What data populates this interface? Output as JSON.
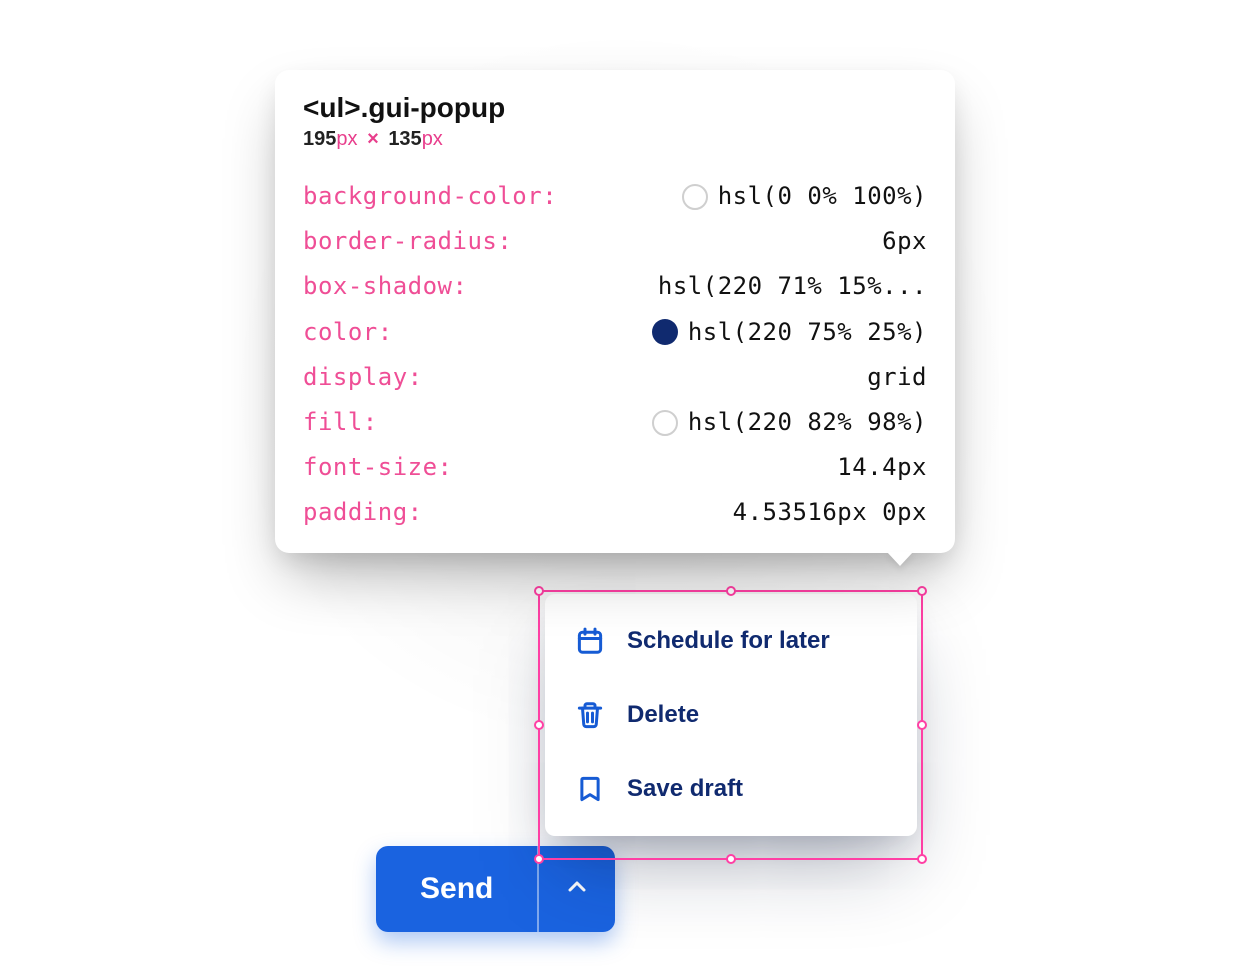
{
  "tooltip": {
    "selector_tag": "<ul>",
    "selector_class": ".gui-popup",
    "dims": {
      "w": "195",
      "h": "135",
      "unit": "px",
      "times": "×"
    },
    "rows": [
      {
        "prop": "background-color",
        "value": "hsl(0 0% 100%)",
        "swatch": "#ffffff",
        "swatch_style": "hollow"
      },
      {
        "prop": "border-radius",
        "value": "6px"
      },
      {
        "prop": "box-shadow",
        "value": "hsl(220 71% 15%..."
      },
      {
        "prop": "color",
        "value": "hsl(220 75% 25%)",
        "swatch": "#102a6f",
        "swatch_style": "filled"
      },
      {
        "prop": "display",
        "value": "grid"
      },
      {
        "prop": "fill",
        "value": "hsl(220 82% 98%)",
        "swatch": "#f5f8fe",
        "swatch_style": "hollow"
      },
      {
        "prop": "font-size",
        "value": "14.4px"
      },
      {
        "prop": "padding",
        "value": "4.53516px 0px"
      }
    ]
  },
  "popup": {
    "items": [
      {
        "icon": "calendar-icon",
        "label": "Schedule for later"
      },
      {
        "icon": "trash-icon",
        "label": "Delete"
      },
      {
        "icon": "bookmark-icon",
        "label": "Save draft"
      }
    ]
  },
  "send_button": {
    "label": "Send"
  },
  "colors": {
    "accent_blue": "#1a63e0",
    "icon_blue": "#165bd4",
    "text_navy": "#102a6f",
    "select_pink": "#ff3fa4",
    "prop_pink": "#ef4e96"
  }
}
